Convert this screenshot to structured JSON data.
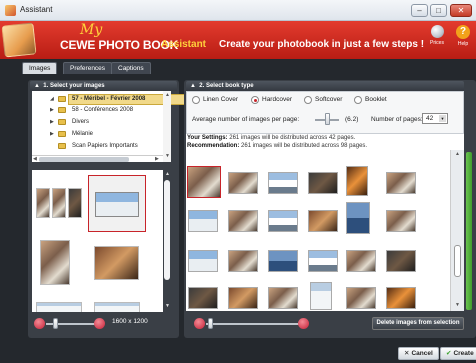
{
  "window": {
    "title": "Assistant"
  },
  "header": {
    "my": "My",
    "brand": "CEWE PHOTO BOOK",
    "assistant": "Assistant",
    "tagline": "Create your photobook in just a few steps !",
    "prices_label": "Prices",
    "help_label": "Help",
    "help_glyph": "?"
  },
  "tabs": [
    {
      "label": "Images",
      "active": true
    },
    {
      "label": "Preferences",
      "active": false
    },
    {
      "label": "Captions",
      "active": false
    }
  ],
  "left": {
    "header": "1. Select your images",
    "tree": [
      {
        "label": "57 - Méribel - Février 2008",
        "selected": true
      },
      {
        "label": "58 - Conférences 2008",
        "selected": false
      },
      {
        "label": "Divers",
        "selected": false
      },
      {
        "label": "Mélanie",
        "selected": false
      },
      {
        "label": "Scan Papiers Importants",
        "selected": false
      }
    ],
    "dimensions": "1600 x 1200"
  },
  "right": {
    "header": "2. Select book type",
    "book_types": [
      {
        "label": "Linen Cover",
        "selected": false
      },
      {
        "label": "Hardcover",
        "selected": true
      },
      {
        "label": "Softcover",
        "selected": false
      },
      {
        "label": "Booklet",
        "selected": false
      }
    ],
    "avg_label": "Average number of images per page:",
    "avg_value": "(6.2)",
    "pages_label": "Number of pages:",
    "pages_value": "42",
    "settings_label": "Your Settings:",
    "settings_text": "261 images will be distributed across 42 pages.",
    "recommendation_label": "Recommendation:",
    "recommendation_text": "261 images will be distributed across 98 pages.",
    "delete_label": "Delete images from selection"
  },
  "footer": {
    "cancel_label": "Cancel",
    "cancel_glyph": "✕",
    "create_label": "Create",
    "create_glyph": "✔"
  }
}
